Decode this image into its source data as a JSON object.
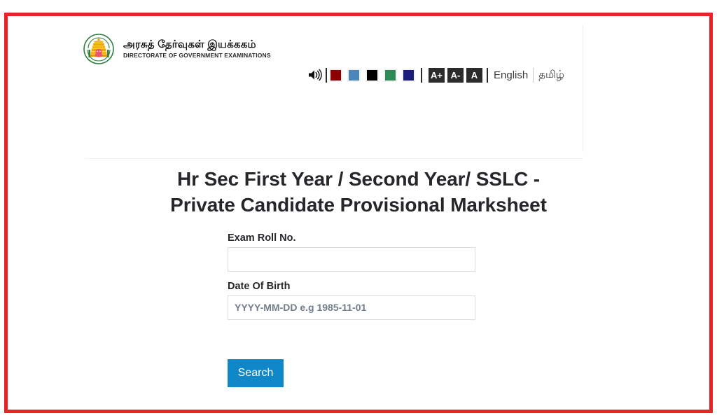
{
  "frame": {
    "border_color": "#e52329"
  },
  "header": {
    "logo": {
      "icon_name": "tamil-nadu-state-emblem",
      "alt": "Government of Tamil Nadu Emblem"
    },
    "org_name_tamil": "அரசுத் தேர்வுகள் இயக்ககம்",
    "org_name_english": "DIRECTORATE OF GOVERNMENT EXAMINATIONS"
  },
  "accessibility": {
    "speaker_icon": "speaker-volume-icon",
    "theme_swatches": [
      {
        "name": "dark-red",
        "color": "#8b0000"
      },
      {
        "name": "steel-blue",
        "color": "#4a86b8"
      },
      {
        "name": "black",
        "color": "#000000"
      },
      {
        "name": "sea-green",
        "color": "#2e8b57"
      },
      {
        "name": "navy",
        "color": "#1d1d7e"
      }
    ],
    "font_size_buttons": [
      {
        "name": "increase",
        "label": "A+"
      },
      {
        "name": "decrease",
        "label": "A-"
      },
      {
        "name": "reset",
        "label": "A"
      }
    ],
    "languages": [
      {
        "name": "english",
        "label": "English"
      },
      {
        "name": "tamil",
        "label": "தமிழ்"
      }
    ]
  },
  "main": {
    "title_line1": "Hr Sec First Year / Second Year/ SSLC -",
    "title_line2": "Private Candidate Provisional Marksheet",
    "fields": {
      "roll_no": {
        "label": "Exam Roll No.",
        "value": "",
        "placeholder": ""
      },
      "dob": {
        "label": "Date Of Birth",
        "value": "",
        "placeholder": "YYYY-MM-DD e.g 1985-11-01"
      }
    },
    "search_button_label": "Search",
    "accent_color": "#1087c8"
  }
}
